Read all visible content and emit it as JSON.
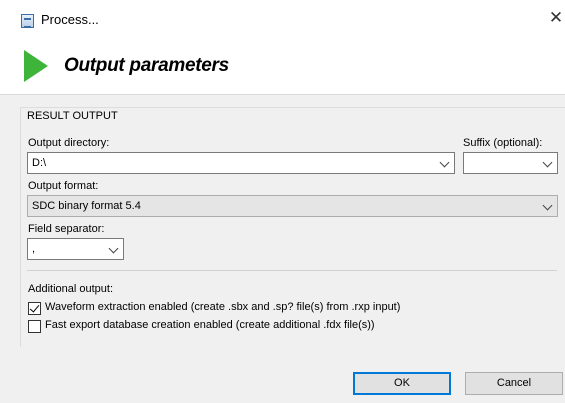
{
  "window": {
    "title": "Process..."
  },
  "header": {
    "title": "Output parameters"
  },
  "result_output": {
    "group_label": "RESULT OUTPUT",
    "output_directory": {
      "label": "Output directory:",
      "value": "D:\\"
    },
    "suffix": {
      "label": "Suffix (optional):",
      "value": ""
    },
    "output_format": {
      "label": "Output format:",
      "value": "SDC binary format 5.4"
    },
    "field_separator": {
      "label": "Field separator:",
      "value": ","
    },
    "additional_output": {
      "label": "Additional output:",
      "options": [
        {
          "label": "Waveform extraction enabled (create .sbx and .sp? file(s) from .rxp input)",
          "checked": true
        },
        {
          "label": "Fast export database creation enabled (create additional .fdx file(s))",
          "checked": false
        }
      ]
    }
  },
  "buttons": {
    "ok": "OK",
    "cancel": "Cancel"
  },
  "icons": {
    "app": "document-icon",
    "header": "play-icon",
    "close": "close-icon"
  },
  "colors": {
    "play_green": "#3fb43a",
    "default_button_border": "#0078d7"
  }
}
